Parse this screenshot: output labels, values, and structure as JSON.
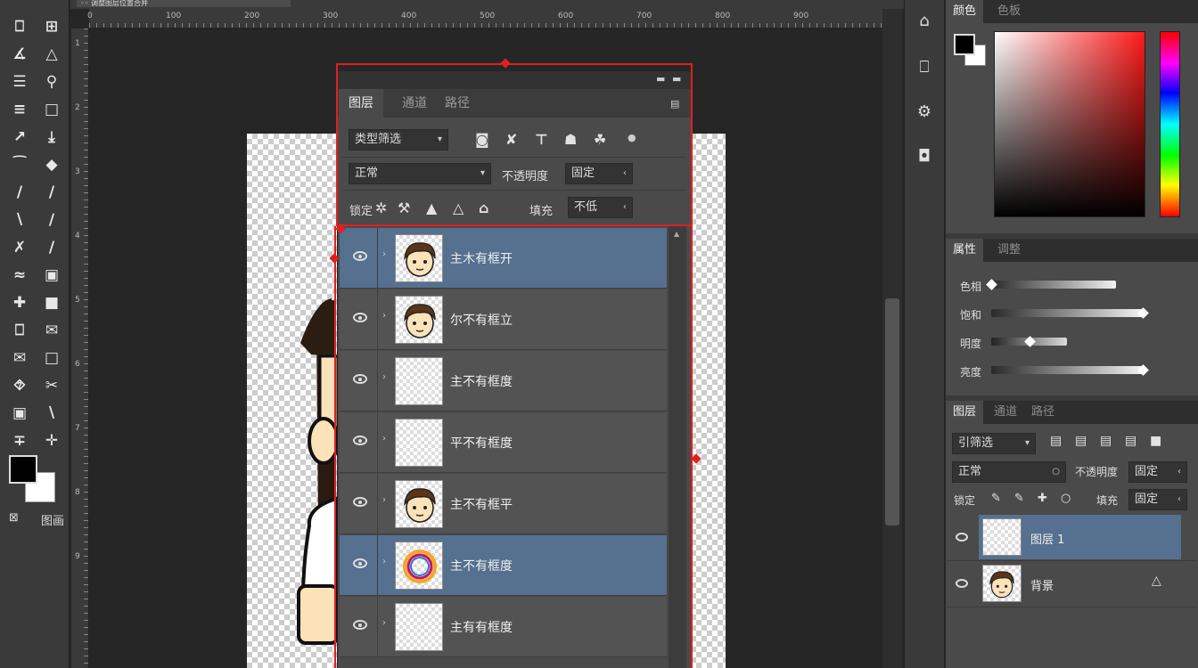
{
  "document_tab": {
    "title": "◦◦ 调整图层位置合并"
  },
  "toolbar": {
    "tools": [
      {
        "glyph": "⎕",
        "name": "move-tool-icon"
      },
      {
        "glyph": "⊞",
        "name": "artboard-tool-icon"
      },
      {
        "glyph": "∡",
        "name": "lasso-tool-icon"
      },
      {
        "glyph": "△",
        "name": "polygon-lasso-icon"
      },
      {
        "glyph": "☰",
        "name": "crop-tool-icon"
      },
      {
        "glyph": "⚲",
        "name": "magic-wand-icon"
      },
      {
        "glyph": "≡",
        "name": "slice-tool-icon"
      },
      {
        "glyph": "□",
        "name": "frame-tool-icon"
      },
      {
        "glyph": "↗",
        "name": "eyedropper-icon"
      },
      {
        "glyph": "⤓",
        "name": "ruler-tool-icon"
      },
      {
        "glyph": "⁀",
        "name": "healing-brush-icon"
      },
      {
        "glyph": "◆",
        "name": "patch-tool-icon"
      },
      {
        "glyph": "∕",
        "name": "brush-tool-icon"
      },
      {
        "glyph": "∕",
        "name": "pencil-tool-icon"
      },
      {
        "glyph": "∖",
        "name": "clone-stamp-icon"
      },
      {
        "glyph": "∕",
        "name": "history-brush-icon"
      },
      {
        "glyph": "✗",
        "name": "eraser-tool-icon"
      },
      {
        "glyph": "∕",
        "name": "bg-eraser-icon"
      },
      {
        "glyph": "≈",
        "name": "gradient-tool-icon"
      },
      {
        "glyph": "▣",
        "name": "paint-bucket-icon"
      },
      {
        "glyph": "✚",
        "name": "blur-tool-icon"
      },
      {
        "glyph": "■",
        "name": "sharpen-tool-icon"
      },
      {
        "glyph": "⎕",
        "name": "dodge-tool-icon"
      },
      {
        "glyph": "✉",
        "name": "burn-tool-icon"
      },
      {
        "glyph": "✉",
        "name": "pen-tool-icon"
      },
      {
        "glyph": "□",
        "name": "freeform-pen-icon"
      },
      {
        "glyph": "⯑",
        "name": "type-tool-icon"
      },
      {
        "glyph": "✂",
        "name": "path-select-icon"
      },
      {
        "glyph": "▣",
        "name": "rectangle-tool-icon"
      },
      {
        "glyph": "∖",
        "name": "line-tool-icon"
      },
      {
        "glyph": "∓",
        "name": "hand-tool-icon"
      },
      {
        "glyph": "✛",
        "name": "zoom-tool-icon"
      }
    ],
    "quick_mask_label": "⊠",
    "screen_mode_label": "图画"
  },
  "rulers": {
    "top": [
      "0",
      "100",
      "200",
      "300",
      "400",
      "500",
      "600",
      "700",
      "800",
      "900"
    ],
    "left": [
      "1",
      "2",
      "3",
      "4",
      "5",
      "6",
      "7",
      "8",
      "9"
    ]
  },
  "float_panel": {
    "tabs": [
      "图层",
      "通道",
      "路径"
    ],
    "kind_filter": "类型筛选",
    "blend_mode": "正常",
    "opacity_label": "不透明度",
    "opacity_value": "固定",
    "lock_label": "锁定",
    "fill_label": "填充",
    "fill_value": "不低",
    "filter_icons": [
      "◙",
      "✘",
      "⊤",
      "☗",
      "☘"
    ],
    "lock_icons": [
      "✲",
      "⚒",
      "▲",
      "△",
      "⌂"
    ],
    "layers": [
      {
        "name": "主木有框开",
        "thumb": "face",
        "selected": true
      },
      {
        "name": "尔不有框立",
        "thumb": "face",
        "selected": false
      },
      {
        "name": "主不有框度",
        "thumb": "empty",
        "selected": false
      },
      {
        "name": "平不有框度",
        "thumb": "empty",
        "selected": false
      },
      {
        "name": "主不有框平",
        "thumb": "face",
        "selected": false
      },
      {
        "name": "主不有框度",
        "thumb": "ring",
        "selected": true
      },
      {
        "name": "主有有框度",
        "thumb": "empty",
        "selected": false
      }
    ]
  },
  "right_strip": [
    "⌂",
    "⎕",
    "⚙",
    "◘"
  ],
  "color_panel": {
    "tabs": [
      "颜色",
      "色板"
    ]
  },
  "adjust_panel": {
    "tabs": [
      "属性",
      "调整"
    ],
    "sliders": [
      {
        "label": "色相",
        "value": 0.0
      },
      {
        "label": "饱和",
        "value": 1.0
      },
      {
        "label": "明度",
        "value": 0.5
      },
      {
        "label": "亮度",
        "value": 1.0
      }
    ]
  },
  "layers_panel": {
    "tabs": [
      "图层",
      "通道",
      "路径"
    ],
    "kind_filter": "引筛选",
    "blend_mode": "正常",
    "opacity_label": "不透明度",
    "opacity_value": "固定",
    "lock_label": "锁定",
    "fill_label": "填充",
    "fill_value": "固定",
    "layers": [
      {
        "name": "图层 1",
        "thumb": "empty",
        "selected": true
      },
      {
        "name": "背景",
        "thumb": "face",
        "selected": false
      }
    ]
  },
  "colors": {
    "selection": "#e02020",
    "selected_layer": "#56708f",
    "panel_bg": "#4a4a4a"
  }
}
